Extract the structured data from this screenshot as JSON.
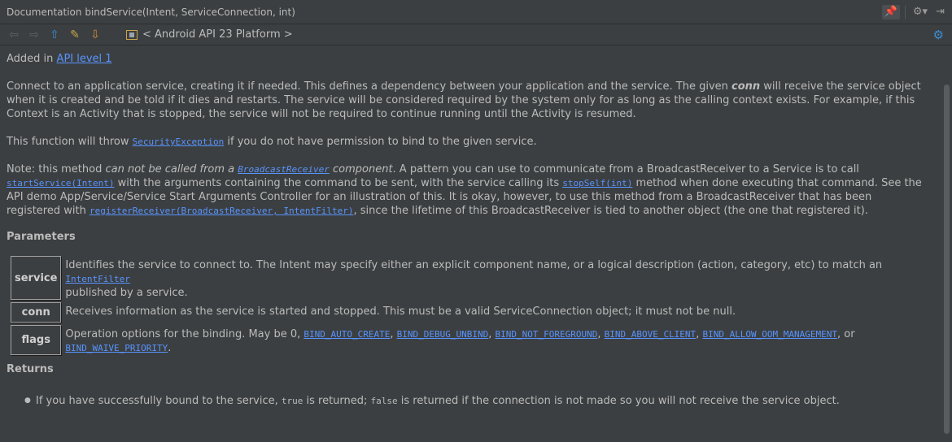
{
  "window": {
    "title": "Documentation bindService(Intent, ServiceConnection, int)"
  },
  "title_tools": {
    "pin": "📌",
    "gear": "⚙▾",
    "hide": "⇥"
  },
  "toolbar": {
    "library": "< Android API 23 Platform >"
  },
  "doc": {
    "added_prefix": "Added in ",
    "added_link": "API level 1",
    "para1_a": "Connect to an application service, creating it if needed. This defines a dependency between your application and the service. The given ",
    "para1_conn": "conn",
    "para1_b": " will receive the service object when it is created and be told if it dies and restarts. The service will be considered required by the system only for as long as the calling context exists. For example, if this Context is an Activity that is stopped, the service will not be required to continue running until the Activity is resumed.",
    "throw_a": "This function will throw ",
    "throw_link": "SecurityException",
    "throw_b": " if you do not have permission to bind to the given service.",
    "note_a": "Note: this method ",
    "note_em1": "can not be called from a ",
    "note_link1": "BroadcastReceiver",
    "note_em2": " component",
    "note_b": ". A pattern you can use to communicate from a BroadcastReceiver to a Service is to call ",
    "note_link2": "startService(Intent)",
    "note_c": " with the arguments containing the command to be sent, with the service calling its ",
    "note_link3": "stopSelf(int)",
    "note_d": " method when done executing that command. See the API demo App/Service/Service Start Arguments Controller for an illustration of this. It is okay, however, to use this method from a BroadcastReceiver that has been registered with ",
    "note_link4": "registerReceiver(BroadcastReceiver, IntentFilter)",
    "note_e": ", since the lifetime of this BroadcastReceiver is tied to another object (the one that registered it).",
    "params_heading": "Parameters",
    "params": [
      {
        "name": "service",
        "desc_a": "Identifies the service to connect to. The Intent may specify either an explicit component name, or a logical description (action, category, etc) to match an ",
        "desc_link": "IntentFilter",
        "desc_b": " published by a service."
      },
      {
        "name": "conn",
        "desc": "Receives information as the service is started and stopped. This must be a valid ServiceConnection object; it must not be null."
      },
      {
        "name": "flags",
        "desc_a": "Operation options for the binding. May be 0, ",
        "links": [
          "BIND_AUTO_CREATE",
          "BIND_DEBUG_UNBIND",
          "BIND_NOT_FOREGROUND",
          "BIND_ABOVE_CLIENT",
          "BIND_ALLOW_OOM_MANAGEMENT",
          "BIND_WAIVE_PRIORITY"
        ],
        "or": ", or",
        "end": "."
      }
    ],
    "returns_heading": "Returns",
    "ret_a": "If you have successfully bound to the service, ",
    "ret_true": "true",
    "ret_b": " is returned; ",
    "ret_false": "false",
    "ret_c": " is returned if the connection is not made so you will not receive the service object."
  }
}
